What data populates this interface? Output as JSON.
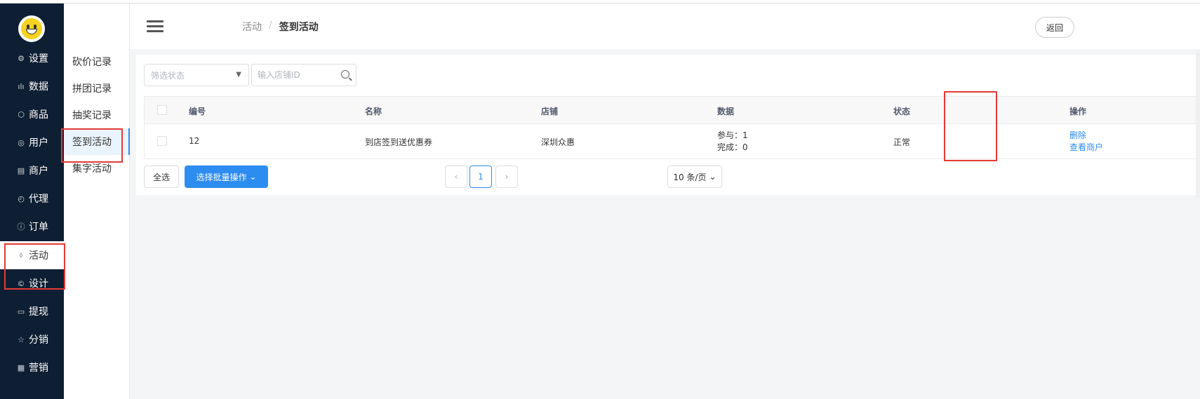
{
  "sidebar": {
    "items": [
      {
        "icon": "gear-icon",
        "glyph": "⚙",
        "label": "设置"
      },
      {
        "icon": "bar-chart-icon",
        "glyph": "ılı",
        "label": "数据"
      },
      {
        "icon": "box-icon",
        "glyph": "⬡",
        "label": "商品"
      },
      {
        "icon": "user-icon",
        "glyph": "◎",
        "label": "用户"
      },
      {
        "icon": "store-icon",
        "glyph": "▤",
        "label": "商户"
      },
      {
        "icon": "clock-icon",
        "glyph": "◴",
        "label": "代理"
      },
      {
        "icon": "info-icon",
        "glyph": "ⓘ",
        "label": "订单"
      },
      {
        "icon": "tag-icon",
        "glyph": "⬨",
        "label": "活动"
      },
      {
        "icon": "copyright-icon",
        "glyph": "©",
        "label": "设计"
      },
      {
        "icon": "card-icon",
        "glyph": "▭",
        "label": "提现"
      },
      {
        "icon": "star-icon",
        "glyph": "☆",
        "label": "分销"
      },
      {
        "icon": "grid-icon",
        "glyph": "▦",
        "label": "营销"
      }
    ]
  },
  "subnav": {
    "items": [
      "砍价记录",
      "拼团记录",
      "抽奖记录",
      "签到活动",
      "集字活动"
    ]
  },
  "header": {
    "breadcrumb_parent": "活动",
    "breadcrumb_sep": "/",
    "breadcrumb_current": "签到活动",
    "back_label": "返回"
  },
  "filters": {
    "status_placeholder": "筛选状态",
    "shop_id_placeholder": "输入店铺ID"
  },
  "table": {
    "headers": {
      "id": "编号",
      "name": "名称",
      "shop": "店铺",
      "data": "数据",
      "status": "状态",
      "ops": "操作"
    },
    "rows": [
      {
        "id": "12",
        "name": "到店签到送优惠券",
        "shop": "深圳众惠",
        "data_join": "参与：1",
        "data_done": "完成：0",
        "status": "正常",
        "op_delete": "删除",
        "op_view": "查看商户"
      }
    ]
  },
  "footer": {
    "select_all": "全选",
    "batch_label": "选择批量操作",
    "current_page": "1",
    "page_size": "10 条/页"
  },
  "colors": {
    "primary": "#2d8cf0",
    "sidebar": "#0f1f33",
    "highlight": "#e53935"
  }
}
